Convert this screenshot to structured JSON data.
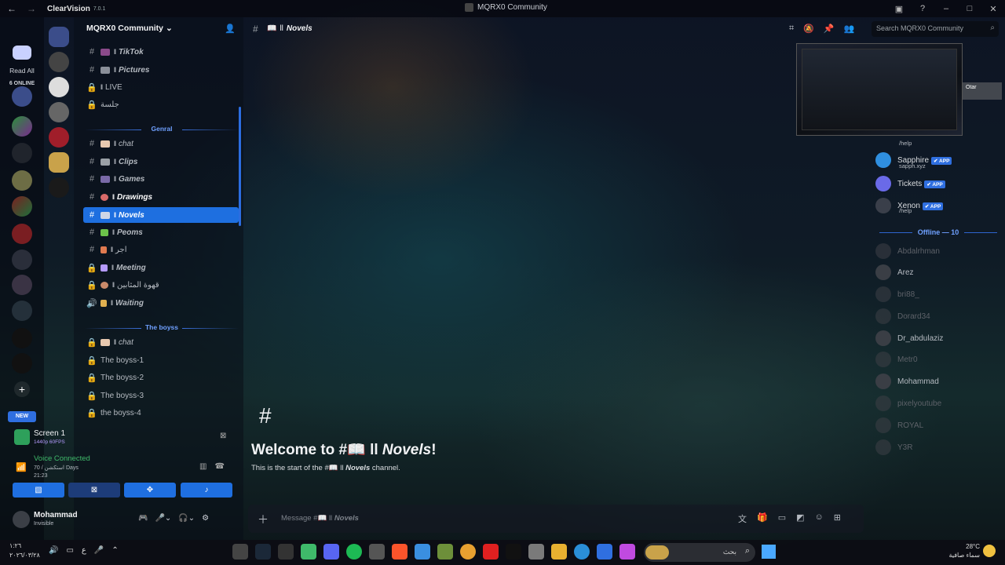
{
  "titlebar": {
    "app_name": "ClearVision",
    "app_version": "7.0.1",
    "window_title": "MQRX0 Community"
  },
  "rail": {
    "read_all": "Read All",
    "online_count": "6 ONLINE",
    "new_label": "NEW",
    "add_label": "+"
  },
  "sidebar": {
    "server_name": "MQRX0 Community",
    "categories": {
      "genral": "Genral",
      "the_boyss": "The boyss"
    },
    "channels": [
      {
        "prefix": "ll",
        "name": "TikTok"
      },
      {
        "prefix": "ll",
        "name": "Pictures"
      },
      {
        "prefix": "ll",
        "name": "LIVE"
      },
      {
        "prefix": "",
        "name": "جلسة"
      },
      {
        "prefix": "ll",
        "name": "chat"
      },
      {
        "prefix": "ll",
        "name": "Clips"
      },
      {
        "prefix": "ll",
        "name": "Games"
      },
      {
        "prefix": "ll",
        "name": "Drawings"
      },
      {
        "prefix": "ll",
        "name": "Novels"
      },
      {
        "prefix": "ll",
        "name": "Peoms"
      },
      {
        "prefix": "ll",
        "name": "اجر"
      },
      {
        "prefix": "ll",
        "name": "Meeting"
      },
      {
        "prefix": "ll",
        "name": "قهوة المثابين"
      },
      {
        "prefix": "ll",
        "name": "Waiting"
      },
      {
        "prefix": "ll",
        "name": "chat"
      },
      {
        "prefix": "",
        "name": "The boyss-1"
      },
      {
        "prefix": "",
        "name": "The boyss-2"
      },
      {
        "prefix": "",
        "name": "The boyss-3"
      },
      {
        "prefix": "",
        "name": "the boyss-4"
      }
    ]
  },
  "panel": {
    "screen_title": "Screen 1",
    "screen_quality": "1440p 60FPS",
    "voice_status": "Voice Connected",
    "voice_channel": "70 / استكشن Days",
    "voice_time": "21:23",
    "user_name": "Mohammad",
    "user_status": "Invisible"
  },
  "chat": {
    "channel_prefix": "ll",
    "channel_name": "Novels",
    "search_placeholder": "Search MQRX0 Community",
    "welcome_hash": "#",
    "welcome_prefix": "Welcome to #📖 ll ",
    "welcome_name": "Novels",
    "welcome_suffix": "!",
    "start_prefix": "This is the start of the #📖 ll ",
    "start_name": "Novels",
    "start_suffix": " channel.",
    "message_prefix": "Message #📖 ll ",
    "message_name": "Novels"
  },
  "members": {
    "pip_tag_name": "Otar",
    "online_apps": [
      {
        "name": "",
        "sub": "/help"
      },
      {
        "name": "Sapphire",
        "tag": "✔ APP",
        "sub": "sapph.xyz"
      },
      {
        "name": "Tickets",
        "tag": "✔ APP",
        "sub": ""
      },
      {
        "name": "Xenon",
        "tag": "✔ APP",
        "sub": "/help"
      }
    ],
    "offline_header": "Offline — 10",
    "offline": [
      "Abdalrhman",
      "Arez",
      "bri88_",
      "Dorard34",
      "Dr_abdulaziz",
      "Metr0",
      "Mohammad",
      "pixelyoutube",
      "ROYAL",
      "Y3R"
    ]
  },
  "taskbar": {
    "time": "١:٢٦",
    "date": "٢٠٢٦/٠٣/٢٨",
    "lang": "ع",
    "search_text": "بحث",
    "temp": "28°C",
    "weather": "سماء صافية"
  }
}
